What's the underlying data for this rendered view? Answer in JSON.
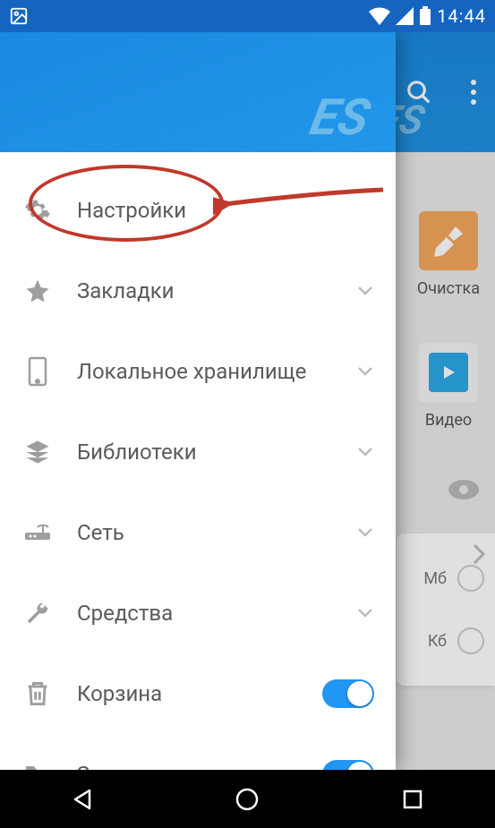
{
  "status": {
    "time": "14:44"
  },
  "background_app": {
    "tiles": {
      "clean_label": "Очистка",
      "video_label": "Видео"
    },
    "side_card": {
      "row1": "Мб",
      "row2": "Кб"
    }
  },
  "drawer": {
    "items": [
      {
        "id": "settings",
        "label": "Настройки",
        "icon": "gear",
        "trailing": "none",
        "highlighted": true
      },
      {
        "id": "bookmarks",
        "label": "Закладки",
        "icon": "star",
        "trailing": "chevron"
      },
      {
        "id": "local",
        "label": "Локальное хранилище",
        "icon": "phone",
        "trailing": "chevron"
      },
      {
        "id": "libraries",
        "label": "Библиотеки",
        "icon": "layers",
        "trailing": "chevron"
      },
      {
        "id": "network",
        "label": "Сеть",
        "icon": "router",
        "trailing": "chevron"
      },
      {
        "id": "tools",
        "label": "Средства",
        "icon": "wrench",
        "trailing": "chevron"
      },
      {
        "id": "trash",
        "label": "Корзина",
        "icon": "trash",
        "trailing": "toggle",
        "toggle_on": true
      },
      {
        "id": "foldericon",
        "label": "Значок на папке",
        "icon": "folder",
        "trailing": "toggle",
        "toggle_on": true
      }
    ]
  }
}
